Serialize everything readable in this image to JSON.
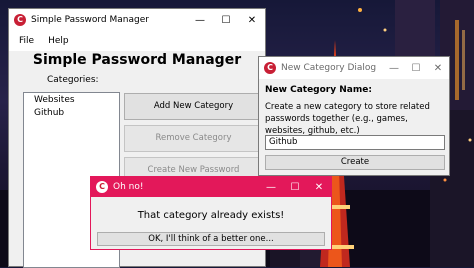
{
  "main_window": {
    "title": "Simple Password Manager",
    "menu": [
      "File",
      "Help"
    ],
    "heading": "Simple Password Manager",
    "categories_label": "Categories:",
    "categories": [
      "Websites",
      "Github"
    ],
    "buttons": {
      "add_category": "Add New Category",
      "remove_category": "Remove Category",
      "create_password": "Create New Password"
    }
  },
  "category_dialog": {
    "title": "New Category Dialog",
    "name_label": "New Category Name:",
    "description": "Create a new category to store related passwords together (e.g., games, websites, github, etc.)",
    "input_value": "Github",
    "create_label": "Create"
  },
  "alert_dialog": {
    "title": "Oh no!",
    "message": "That category already exists!",
    "ok_label": "OK, I'll think of a better one..."
  },
  "window_controls": {
    "minimize": "—",
    "maximize": "☐",
    "close": "✕"
  },
  "colors": {
    "app_icon": "#c81f35",
    "alert_titlebar": "#e3185a",
    "dialog_titlebar": "#ffffff"
  },
  "icons": {
    "app_icon": "C"
  }
}
